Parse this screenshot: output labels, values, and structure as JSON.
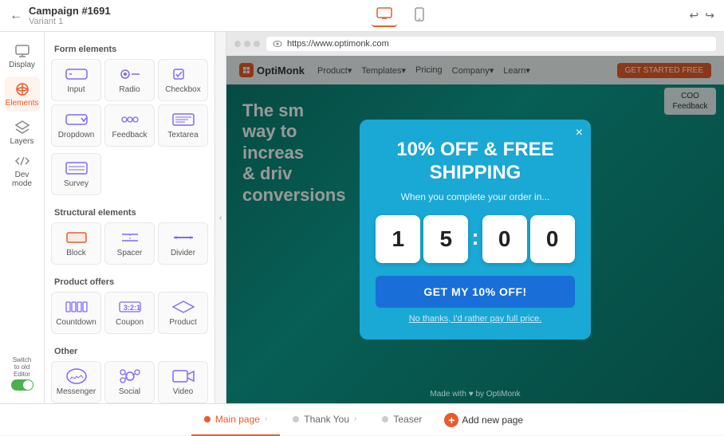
{
  "topbar": {
    "campaign_title": "Campaign #1691",
    "variant_label": "Variant 1",
    "url": "https://www.optimonk.com"
  },
  "sidebar_icons": [
    {
      "id": "display",
      "label": "Display",
      "icon": "display"
    },
    {
      "id": "elements",
      "label": "Elements",
      "icon": "elements",
      "active": true
    },
    {
      "id": "layers",
      "label": "Layers",
      "icon": "layers"
    },
    {
      "id": "devmode",
      "label": "Dev mode",
      "icon": "devmode"
    }
  ],
  "sections": [
    {
      "title": "Form elements",
      "items": [
        {
          "id": "input",
          "label": "Input"
        },
        {
          "id": "radio",
          "label": "Radio"
        },
        {
          "id": "checkbox",
          "label": "Checkbox"
        },
        {
          "id": "dropdown",
          "label": "Dropdown"
        },
        {
          "id": "feedback",
          "label": "Feedback"
        },
        {
          "id": "textarea",
          "label": "Textarea"
        },
        {
          "id": "survey",
          "label": "Survey"
        }
      ]
    },
    {
      "title": "Structural elements",
      "items": [
        {
          "id": "block",
          "label": "Block"
        },
        {
          "id": "spacer",
          "label": "Spacer"
        },
        {
          "id": "divider",
          "label": "Divider"
        }
      ]
    },
    {
      "title": "Product offers",
      "items": [
        {
          "id": "countdown",
          "label": "Countdown"
        },
        {
          "id": "coupon",
          "label": "Coupon"
        },
        {
          "id": "product",
          "label": "Product"
        }
      ]
    },
    {
      "title": "Other",
      "items": [
        {
          "id": "messenger",
          "label": "Messenger"
        },
        {
          "id": "social",
          "label": "Social"
        },
        {
          "id": "video",
          "label": "Video"
        }
      ]
    }
  ],
  "popup": {
    "title": "10% OFF & FREE SHIPPING",
    "subtitle": "When you complete your order in...",
    "countdown": [
      "1",
      "5",
      "0",
      "0"
    ],
    "cta_label": "GET MY 10% OFF!",
    "decline_label": "No thanks, I'd rather pay full price.",
    "close_label": "×"
  },
  "coo_feedback_label": "COO Feedback",
  "watermark": "Made with ♥ by OptiMonk",
  "bottom_tabs": [
    {
      "id": "main",
      "label": "Main page",
      "active": true
    },
    {
      "id": "thankyou",
      "label": "Thank You",
      "active": false
    },
    {
      "id": "teaser",
      "label": "Teaser",
      "active": false
    }
  ],
  "add_page_label": "Add new page",
  "switch_editor": {
    "line1": "Switch",
    "line2": "to old",
    "line3": "Editor"
  },
  "nav": {
    "logo": "OptiMonk",
    "links": [
      "Product▾",
      "Templates▾",
      "Pricing",
      "Company▾",
      "Learn▾"
    ],
    "cta": "GET STARTED FREE"
  },
  "hero_text": "The sm way to increas & driv conversion"
}
